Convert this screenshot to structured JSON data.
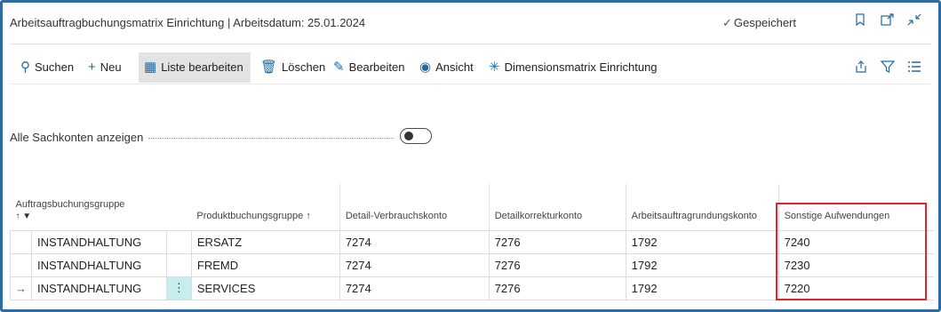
{
  "window": {
    "title": "Arbeitsauftragbuchungsmatrix Einrichtung | Arbeitsdatum: 25.01.2024",
    "saved_label": "Gespeichert",
    "saved_icon": "check-icon",
    "title_icons": [
      "bookmark-icon",
      "open-new-window-icon",
      "collapse-icon"
    ]
  },
  "toolbar": {
    "search": "Suchen",
    "new": "Neu",
    "edit_list": "Liste bearbeiten",
    "delete": "Löschen",
    "edit": "Bearbeiten",
    "view": "Ansicht",
    "dimension_matrix": "Dimensionsmatrix Einrichtung",
    "right_icons": [
      "share-icon",
      "filter-icon",
      "list-view-icon"
    ]
  },
  "filter": {
    "label": "Alle Sachkonten anzeigen",
    "toggle_on": false
  },
  "grid": {
    "columns": [
      "Auftragsbuchungsgruppe",
      "Produktbuchungsgruppe ↑",
      "Detail-Verbrauchskonto",
      "Detailkorrekturkonto",
      "Arbeitsauftragrundungskonto",
      "Sonstige Aufwendungen"
    ],
    "first_column_sort": "↑",
    "rows": [
      {
        "selector": "",
        "group": "INSTANDHALTUNG",
        "menu": "",
        "product": "ERSATZ",
        "consumption": "7274",
        "correction": "7276",
        "rounding": "1792",
        "other": "7240"
      },
      {
        "selector": "",
        "group": "INSTANDHALTUNG",
        "menu": "",
        "product": "FREMD",
        "consumption": "7274",
        "correction": "7276",
        "rounding": "1792",
        "other": "7230"
      },
      {
        "selector": "→",
        "group": "INSTANDHALTUNG",
        "menu": "⋮",
        "product": "SERVICES",
        "consumption": "7274",
        "correction": "7276",
        "rounding": "1792",
        "other": "7220"
      }
    ]
  },
  "colors": {
    "frame_border": "#2f6aa0",
    "accent": "#1f6aa5",
    "highlight_box": "#e0252b",
    "active_cell": "#c9ecef"
  }
}
